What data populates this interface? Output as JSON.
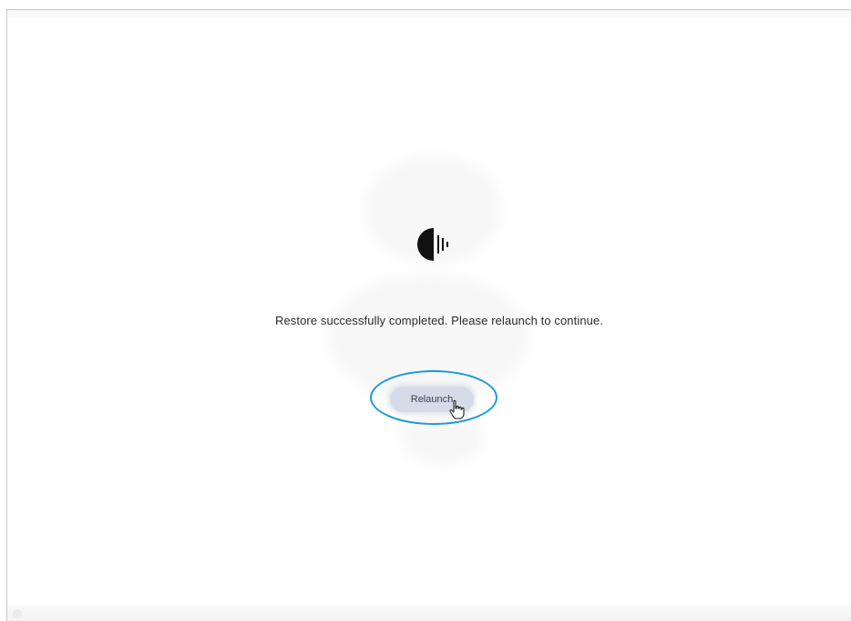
{
  "app": {
    "logo_icon": "half-circle-soundwave-icon"
  },
  "dialog": {
    "message": "Restore successfully completed. Please relaunch to continue.",
    "relaunch_label": "Relaunch",
    "cursor_icon": "hand-pointer-icon",
    "highlight_color": "#1b9ad6",
    "button_color": "#d7dbe9"
  }
}
